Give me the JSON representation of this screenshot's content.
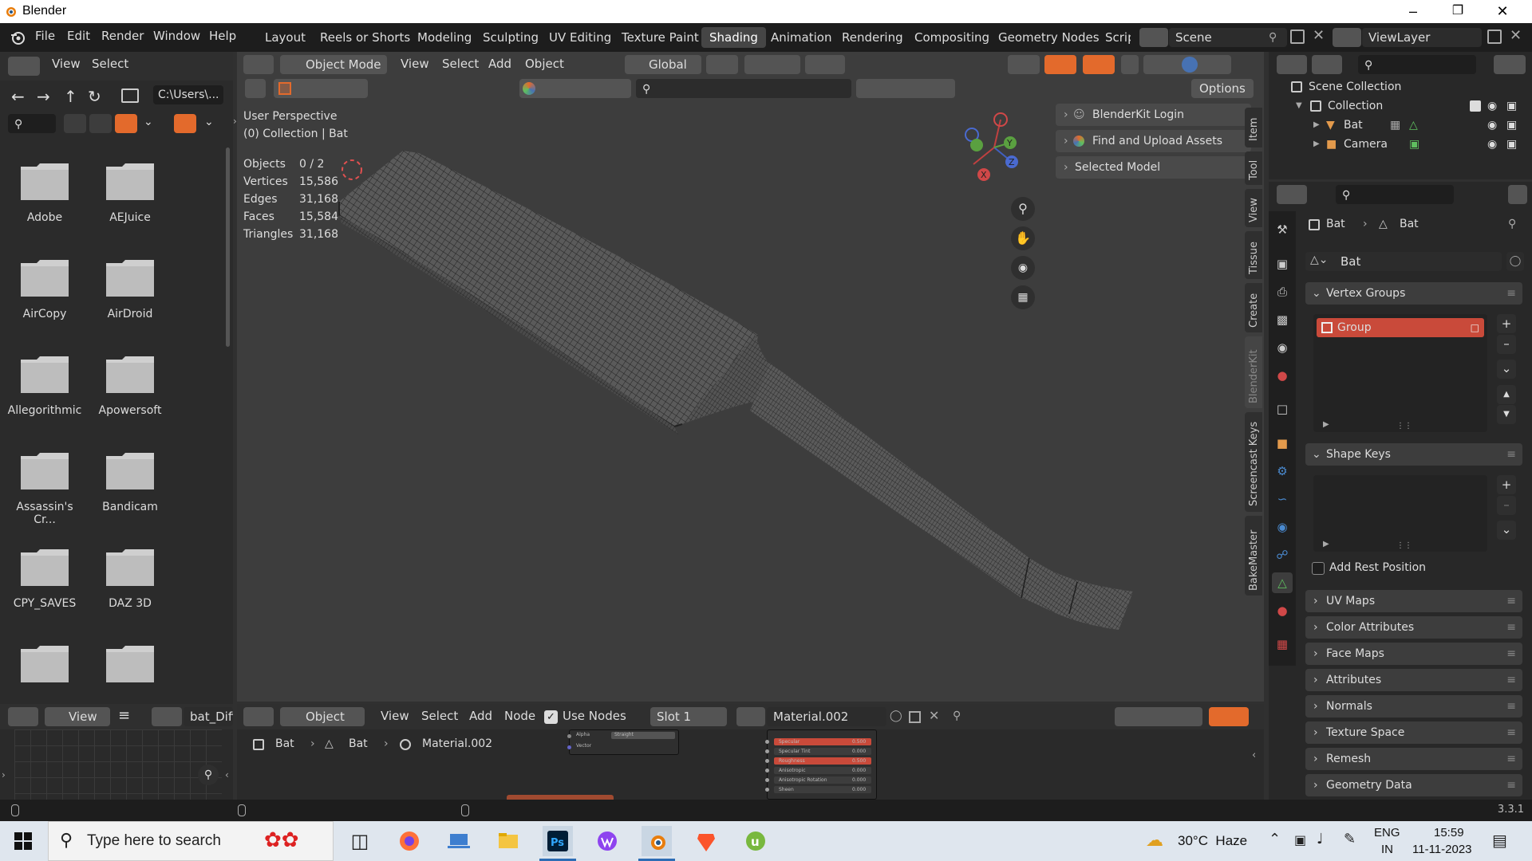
{
  "window": {
    "title": "Blender",
    "controls": [
      "minimize",
      "maximize",
      "close"
    ]
  },
  "topbar": {
    "menus": [
      "File",
      "Edit",
      "Render",
      "Window",
      "Help"
    ],
    "workspaces": [
      "Layout",
      "Reels or Shorts",
      "Modeling",
      "Sculpting",
      "UV Editing",
      "Texture Paint",
      "Shading",
      "Animation",
      "Rendering",
      "Compositing",
      "Geometry Nodes",
      "Scrip"
    ],
    "active_workspace": "Shading",
    "scene": "Scene",
    "view_layer": "ViewLayer"
  },
  "file_browser": {
    "menus": [
      "View",
      "Select"
    ],
    "path": "C:\\Users\\...",
    "folders": [
      "Adobe",
      "AEJuice",
      "AirCopy",
      "AirDroid",
      "Allegorithmic",
      "Apowersoft",
      "Assassin's Cr...",
      "Bandicam",
      "CPY_SAVES",
      "DAZ 3D",
      "",
      ""
    ]
  },
  "viewport": {
    "mode": "Object Mode",
    "menus": [
      "View",
      "Select",
      "Add",
      "Object"
    ],
    "transform_orientation": "Global",
    "options_label": "Options",
    "perspective_label": "User Perspective",
    "collection_label": "(0) Collection | Bat",
    "stats": [
      {
        "label": "Objects",
        "value": "0 / 2"
      },
      {
        "label": "Vertices",
        "value": "15,586"
      },
      {
        "label": "Edges",
        "value": "31,168"
      },
      {
        "label": "Faces",
        "value": "15,584"
      },
      {
        "label": "Triangles",
        "value": "31,168"
      }
    ],
    "gizmo_axes": {
      "x": "X",
      "y": "Y",
      "z": "Z"
    },
    "npanels": [
      "BlenderKit Login",
      "Find and Upload Assets",
      "Selected Model"
    ],
    "sidebar_tabs": [
      "Item",
      "Tool",
      "View",
      "Tissue",
      "Create",
      "BlenderKit",
      "Screencast Keys",
      "BakeMaster"
    ]
  },
  "outliner": {
    "scene_collection": "Scene Collection",
    "collection": "Collection",
    "items": [
      "Bat",
      "Camera"
    ]
  },
  "properties": {
    "breadcrumb": [
      "Bat",
      "Bat"
    ],
    "mesh_name": "Bat",
    "vertex_groups_title": "Vertex Groups",
    "vertex_group_item": "Group",
    "shape_keys_title": "Shape Keys",
    "add_rest_position": "Add Rest Position",
    "collapsed_panels": [
      "UV Maps",
      "Color Attributes",
      "Face Maps",
      "Attributes",
      "Normals",
      "Texture Space",
      "Remesh",
      "Geometry Data"
    ]
  },
  "node_editor": {
    "object_mode": "Object",
    "menus": [
      "View",
      "Select",
      "Add",
      "Node"
    ],
    "use_nodes": "Use Nodes",
    "slot": "Slot 1",
    "material": "Material.002",
    "breadcrumb": [
      "Bat",
      "Bat",
      "Material.002"
    ],
    "node_rows": [
      "Specular",
      "Specular Tint",
      "Roughness",
      "Anisotropic",
      "Anisotropic Rotation",
      "Sheen"
    ],
    "node_values": [
      "0.500",
      "0.000",
      "0.500",
      "0.000",
      "0.000",
      "0.000"
    ],
    "small_node_rows": [
      "Alpha",
      "Vector"
    ],
    "small_node_value": "Straight"
  },
  "image_editor": {
    "menu": "View",
    "image_name": "bat_Diffu"
  },
  "statusbar": {
    "version": "3.3.1"
  },
  "taskbar": {
    "search_placeholder": "Type here to search",
    "weather": "30°C  Haze",
    "lang_top": "ENG",
    "lang_bottom": "IN",
    "time": "15:59",
    "date": "11-11-2023"
  },
  "colors": {
    "accent_orange": "#e36a2c",
    "active_blue": "#4772b3",
    "vertex_group_red": "#c94a3a"
  }
}
